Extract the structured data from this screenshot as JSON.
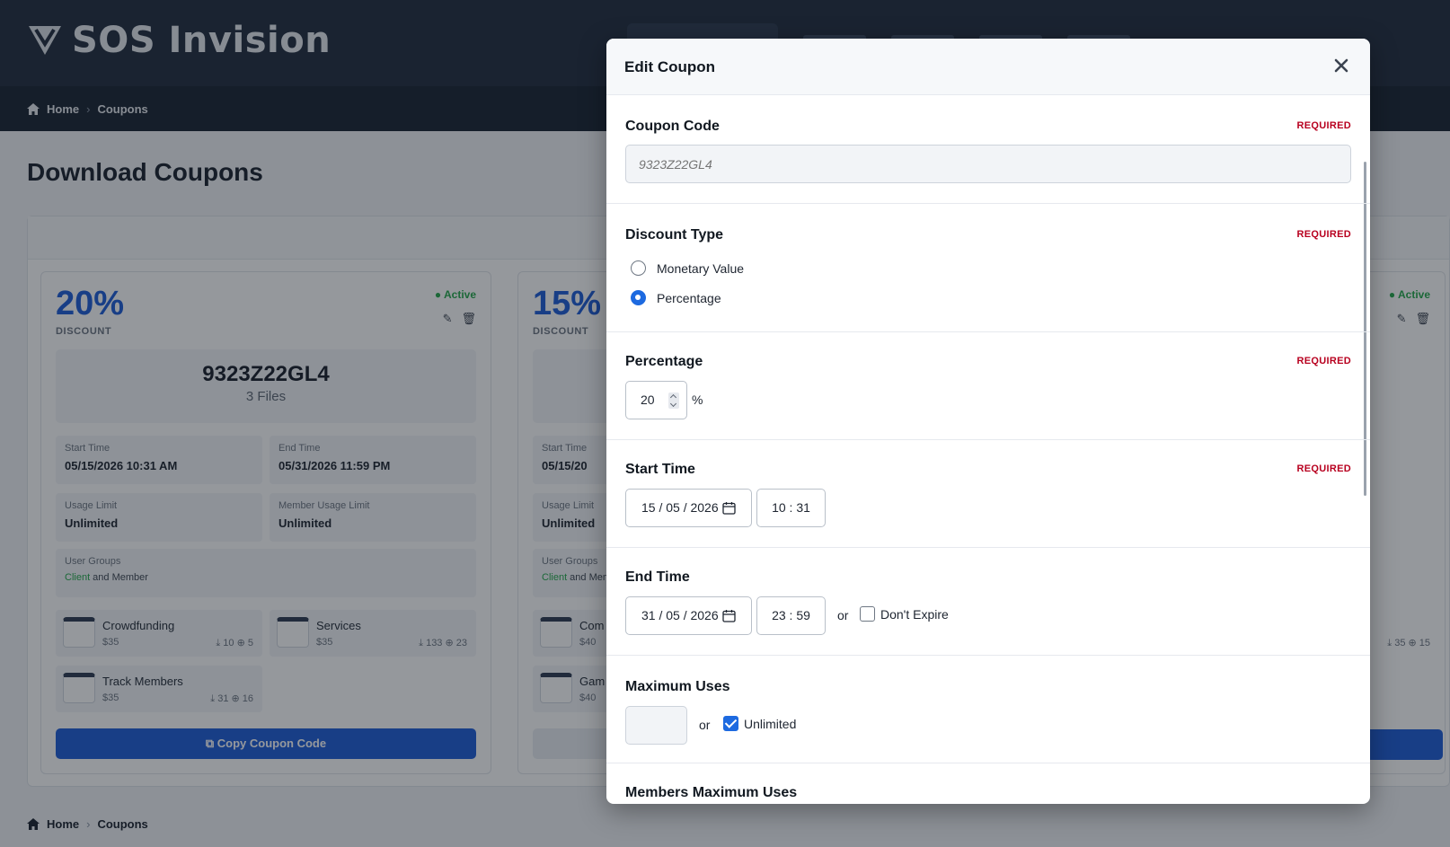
{
  "app": {
    "brand": "SOS Invision"
  },
  "breadcrumb": {
    "home": "Home",
    "current": "Coupons"
  },
  "page": {
    "title": "Download Coupons"
  },
  "cards": [
    {
      "discount_value": "20%",
      "discount_label": "DISCOUNT",
      "status": "● Active",
      "code": "9323Z22GL4",
      "files_count": "3 Files",
      "start_time_label": "Start Time",
      "start_time": "05/15/2026 10:31 AM",
      "end_time_label": "End Time",
      "end_time": "05/31/2026 11:59 PM",
      "usage_limit_label": "Usage Limit",
      "usage_limit": "Unlimited",
      "member_usage_limit_label": "Member Usage Limit",
      "member_usage_limit": "Unlimited",
      "user_groups_label": "User Groups",
      "user_groups_client": "Client",
      "user_groups_rest": " and Member",
      "files": [
        {
          "name": "Crowdfunding",
          "price": "$35",
          "stats": "⤓ 10  ⊕ 5"
        },
        {
          "name": "Services",
          "price": "$35",
          "stats": "⤓ 133  ⊕ 23"
        },
        {
          "name": "Track Members",
          "price": "$35",
          "stats": "⤓ 31  ⊕ 16"
        }
      ],
      "copy_button": "⧉ Copy Coupon Code"
    },
    {
      "discount_value": "15%",
      "discount_label": "DISCOUNT",
      "start_time_label": "Start Time",
      "start_time": "05/15/20",
      "usage_limit_label": "Usage Limit",
      "usage_limit": "Unlimited",
      "user_groups_label": "User Groups",
      "user_groups_client": "Client",
      "user_groups_rest": " and Mem",
      "files": [
        {
          "name": "Com",
          "price": "$40"
        },
        {
          "name": "Gam",
          "price": "$40"
        }
      ]
    },
    {
      "status": "● Active",
      "stats": "⤓ 35  ⊕ 15"
    }
  ],
  "modal": {
    "title": "Edit Coupon",
    "close_icon": "close-icon",
    "required_label": "REQUIRED",
    "coupon_code": {
      "label": "Coupon Code",
      "placeholder": "9323Z22GL4"
    },
    "discount_type": {
      "label": "Discount Type",
      "options": [
        {
          "label": "Monetary Value",
          "selected": false
        },
        {
          "label": "Percentage",
          "selected": true
        }
      ]
    },
    "percentage": {
      "label": "Percentage",
      "value": "20",
      "unit": "%"
    },
    "start_time": {
      "label": "Start Time",
      "date": "15 / 05 / 2026",
      "time": "10 : 31"
    },
    "end_time": {
      "label": "End Time",
      "date": "31 / 05 / 2026",
      "time": "23 : 59",
      "or": "or",
      "dont_expire": "Don't Expire",
      "dont_expire_checked": false
    },
    "max_uses": {
      "label": "Maximum Uses",
      "value": "",
      "or": "or",
      "unlimited": "Unlimited",
      "unlimited_checked": true
    },
    "members_max_uses": {
      "label": "Members Maximum Uses"
    }
  },
  "colors": {
    "accent": "#1d5bd8",
    "required": "#b8001f",
    "active": "#23a84a",
    "header_bg": "#1f2b3d"
  }
}
